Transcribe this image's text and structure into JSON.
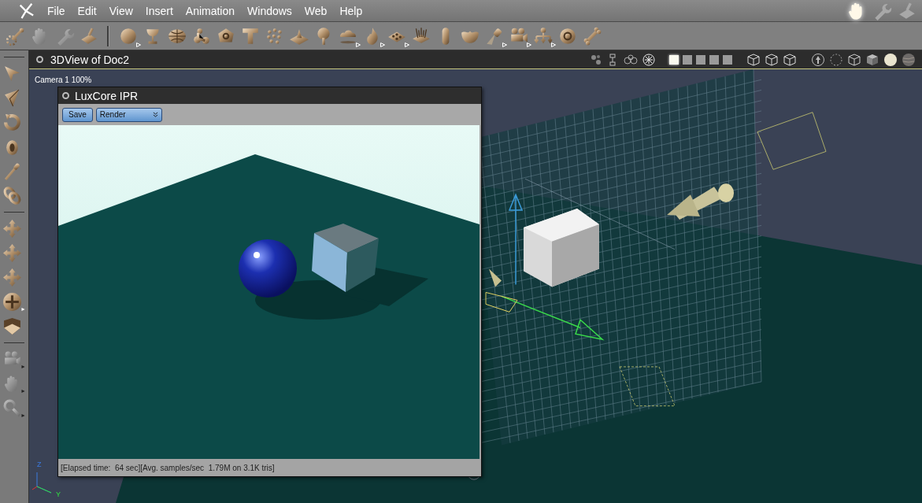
{
  "menu": {
    "items": [
      "File",
      "Edit",
      "View",
      "Insert",
      "Animation",
      "Windows",
      "Web",
      "Help"
    ]
  },
  "rooms": [
    {
      "kind": "hand",
      "selected": true
    },
    {
      "kind": "wrench",
      "selected": false
    },
    {
      "kind": "brush",
      "selected": false
    }
  ],
  "toolbar": {
    "tools": [
      {
        "kind": "wand",
        "disabled": false
      },
      {
        "kind": "hand",
        "disabled": true
      },
      {
        "kind": "wrench",
        "disabled": true
      },
      {
        "kind": "brush",
        "disabled": false
      },
      {
        "kind": "sphere",
        "disabled": false
      },
      {
        "kind": "goblet",
        "disabled": false
      },
      {
        "kind": "globe",
        "disabled": false
      },
      {
        "kind": "blob",
        "disabled": false
      },
      {
        "kind": "ring",
        "disabled": false
      },
      {
        "kind": "letter",
        "disabled": false
      },
      {
        "kind": "dots",
        "disabled": false
      },
      {
        "kind": "terrain",
        "disabled": false
      },
      {
        "kind": "tree",
        "disabled": false
      },
      {
        "kind": "cloud",
        "disabled": false
      },
      {
        "kind": "fire",
        "disabled": false
      },
      {
        "kind": "plants",
        "disabled": false
      },
      {
        "kind": "grass",
        "disabled": false
      },
      {
        "kind": "cylinder",
        "disabled": false
      },
      {
        "kind": "bowl",
        "disabled": false
      },
      {
        "kind": "spotlight",
        "disabled": false
      },
      {
        "kind": "camera",
        "disabled": false
      },
      {
        "kind": "distribute",
        "disabled": false
      },
      {
        "kind": "target",
        "disabled": false
      },
      {
        "kind": "bone",
        "disabled": false
      }
    ]
  },
  "view": {
    "title": "3DView of Doc2",
    "camera_label": "Camera 1 100%",
    "layouts": [
      {
        "selected": true
      },
      {
        "selected": false
      },
      {
        "selected": false
      },
      {
        "selected": false
      },
      {
        "selected": false
      }
    ]
  },
  "left_tools": [
    {
      "kind": "arrow",
      "disabled": false
    },
    {
      "kind": "cone",
      "disabled": false
    },
    {
      "kind": "rotate",
      "disabled": false
    },
    {
      "kind": "scale",
      "disabled": false
    },
    {
      "kind": "dropper",
      "disabled": false
    },
    {
      "kind": "chain",
      "disabled": false
    },
    {
      "kind": "move",
      "disabled": false
    },
    {
      "kind": "move",
      "disabled": false
    },
    {
      "kind": "move",
      "disabled": false
    },
    {
      "kind": "trackball",
      "disabled": false
    },
    {
      "kind": "box",
      "disabled": false
    },
    {
      "kind": "camera",
      "disabled": true
    },
    {
      "kind": "hand",
      "disabled": true
    },
    {
      "kind": "zoom",
      "disabled": true
    }
  ],
  "ipr": {
    "title": "LuxCore IPR",
    "save_button": "Save",
    "mode_select": {
      "value": "Render"
    },
    "status": "[Elapsed time:  64 sec][Avg. samples/sec  1.79M on 3.1K tris]"
  },
  "axis_labels": [
    "Z",
    "Y"
  ]
}
